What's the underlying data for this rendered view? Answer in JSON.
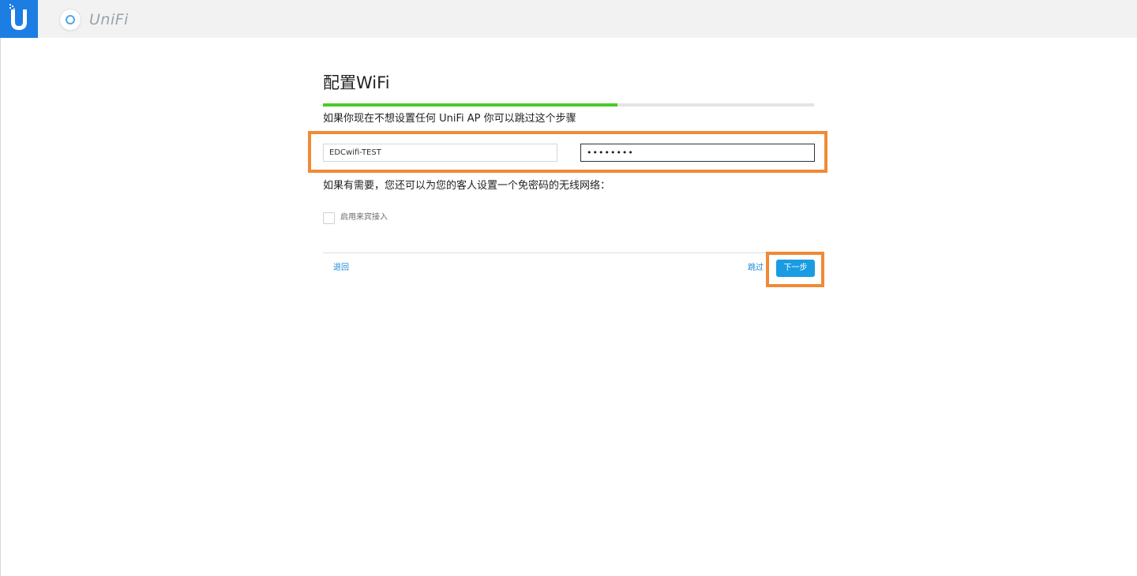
{
  "header": {
    "logo_icon": "ubiquiti-u-logo-icon",
    "brand_icon": "unifi-device-icon",
    "brand_name": "UniFi"
  },
  "setup": {
    "title": "配置WiFi",
    "progress_percent": 60,
    "skip_hint": "如果你现在不想设置任何 UniFi AP 你可以跳过这个步骤",
    "ssid_value": "EDCwifi-TEST",
    "password_value": "••••••••",
    "guest_hint": "如果有需要，您还可以为您的客人设置一个免密码的无线网络：",
    "guest_label": "启用来宾接入",
    "guest_checked": false
  },
  "footer": {
    "back_label": "退回",
    "skip_label": "跳过",
    "next_label": "下一步"
  },
  "colors": {
    "brand_blue": "#1c7ee3",
    "progress_green": "#4cca2b",
    "link_blue": "#1a87d6",
    "button_blue": "#1a9ce3",
    "highlight_orange": "#f08a36"
  }
}
